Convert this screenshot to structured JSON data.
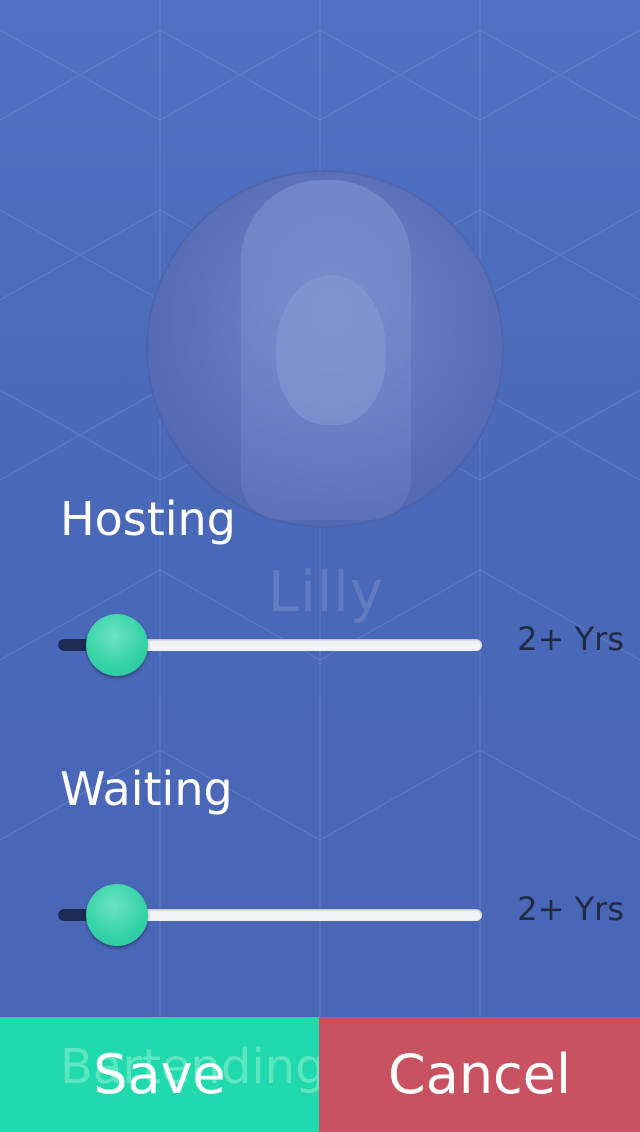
{
  "profile": {
    "name": "Lilly"
  },
  "skills": [
    {
      "title": "Hosting",
      "value_label": "2+ Yrs",
      "level": 0.14
    },
    {
      "title": "Waiting",
      "value_label": "2+ Yrs",
      "level": 0.14
    }
  ],
  "hidden_section": {
    "title": "Bartending"
  },
  "actions": {
    "save_label": "Save",
    "cancel_label": "Cancel"
  },
  "colors": {
    "background": "#4a6bbf",
    "accent_green": "#20d9ad",
    "cancel_red": "#c8525f",
    "slider_fill": "#1d2b55"
  }
}
